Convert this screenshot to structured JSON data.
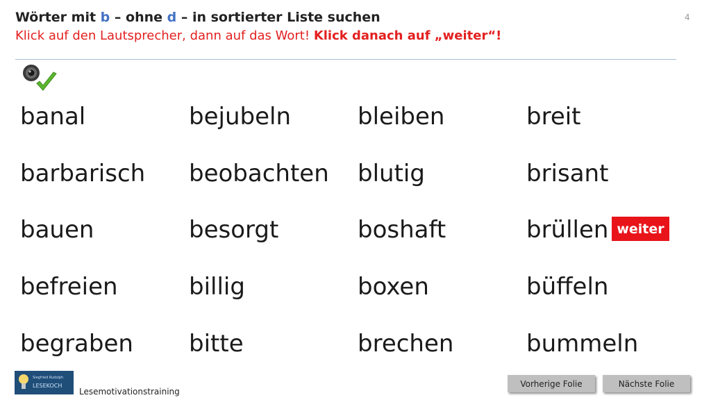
{
  "header": {
    "title_part1": "Wörter mit ",
    "title_b": "b",
    "title_part2": " – ohne ",
    "title_d": "d",
    "title_part3": " – in sortierter Liste suchen",
    "instruction": "Klick auf den Lautsprecher, dann auf das Wort! ",
    "instruction_bold": "Klick danach auf „weiter“!",
    "slide_number": "4"
  },
  "words": {
    "col1": [
      "banal",
      "barbarisch",
      "bauen",
      "befreien",
      "begraben"
    ],
    "col2": [
      "bejubeln",
      "beobachten",
      "besorgt",
      "billig",
      "bitte"
    ],
    "col3": [
      "bleiben",
      "blutig",
      "boshaft",
      "boxen",
      "brechen"
    ],
    "col4": [
      "breit",
      "brisant",
      "brüllen",
      "büffeln",
      "bummeln"
    ]
  },
  "buttons": {
    "weiter": "weiter",
    "previous": "Vorherige  Folie",
    "next": "Nächste  Folie"
  },
  "footer": {
    "label": "Lesemotivationstraining",
    "logo_small": "Siegfried Rudolph",
    "logo_text": "LESEKOCH"
  },
  "icons": {
    "speaker": "speaker-icon",
    "check": "checkmark-icon"
  },
  "colors": {
    "accent_red": "#e8141a",
    "instruction_red": "#e32020",
    "letter_blue": "#4472c4",
    "nav_gray": "#bfbfbf"
  }
}
